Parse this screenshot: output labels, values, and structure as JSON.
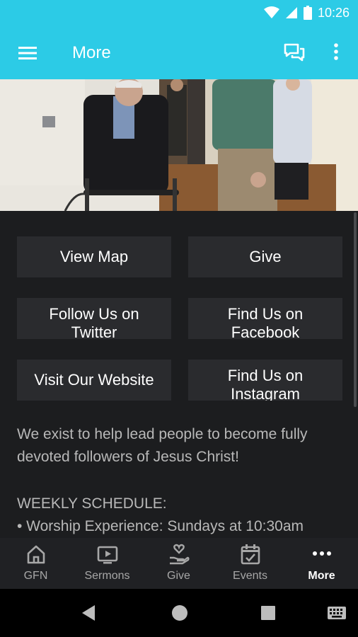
{
  "status_bar": {
    "time": "10:26"
  },
  "app_bar": {
    "title": "More"
  },
  "buttons": [
    {
      "label": "View Map"
    },
    {
      "label": "Give"
    },
    {
      "label": "Follow Us on Twitter"
    },
    {
      "label": "Find Us on Facebook"
    },
    {
      "label": "Visit Our Website"
    },
    {
      "label": "Find Us on Instagram"
    }
  ],
  "about": {
    "text": "We exist to help lead people to become fully devoted followers of Jesus Christ!",
    "schedule_heading": "WEEKLY SCHEDULE:",
    "schedule_item": "• Worship Experience: Sundays at 10:30am"
  },
  "bottom_nav": {
    "items": [
      {
        "label": "GFN",
        "icon": "home-icon"
      },
      {
        "label": "Sermons",
        "icon": "play-icon"
      },
      {
        "label": "Give",
        "icon": "give-icon"
      },
      {
        "label": "Events",
        "icon": "calendar-icon"
      },
      {
        "label": "More",
        "icon": "more-icon"
      }
    ],
    "active": "More"
  },
  "colors": {
    "accent": "#2ccbe6",
    "background": "#1c1d1f",
    "button": "#2a2b2e"
  }
}
